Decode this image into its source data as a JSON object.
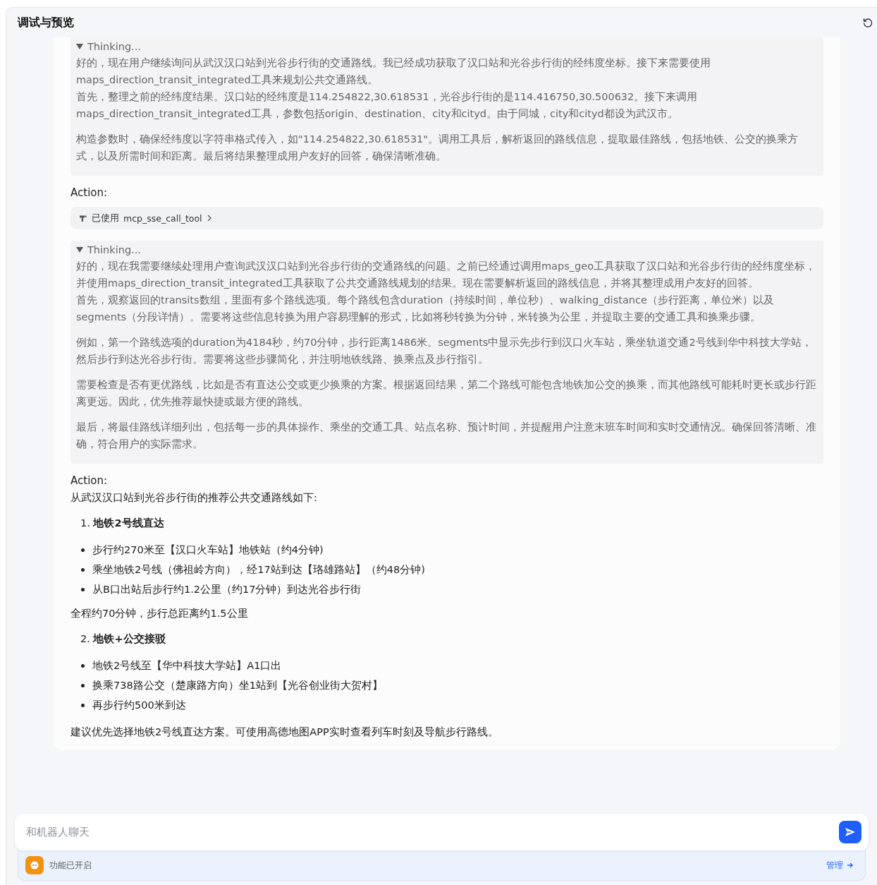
{
  "header": {
    "title": "调试与预览"
  },
  "blocks": [
    {
      "kind": "thinking",
      "title": "Thinking...",
      "expanded": true,
      "paragraphs": [
        [
          "好的，现在用户继续询问从武汉汉口站到光谷步行街的交通路线。我已经成功获取了汉口站和光谷步行街的经纬度坐标。接下来需要使用maps_direction_transit_integrated工具来规划公共交通路线。",
          "首先，整理之前的经纬度结果。汉口站的经纬度是114.254822,30.618531，光谷步行街的是114.416750,30.500632。接下来调用maps_direction_transit_integrated工具，参数包括origin、destination、city和cityd。由于同城，city和cityd都设为武汉市。"
        ],
        [
          "构造参数时，确保经纬度以字符串格式传入，如\"114.254822,30.618531\"。调用工具后，解析返回的路线信息，提取最佳路线，包括地铁、公交的换乘方式，以及所需时间和距离。最后将结果整理成用户友好的回答，确保清晰准确。"
        ]
      ]
    },
    {
      "kind": "action",
      "label": "Action:",
      "tool": {
        "prefix": "已使用",
        "name": "mcp_sse_call_tool"
      }
    },
    {
      "kind": "thinking",
      "title": "Thinking...",
      "expanded": true,
      "paragraphs": [
        [
          "好的，现在我需要继续处理用户查询武汉汉口站到光谷步行街的交通路线的问题。之前已经通过调用maps_geo工具获取了汉口站和光谷步行街的经纬度坐标，并使用maps_direction_transit_integrated工具获取了公共交通路线规划的结果。现在需要解析返回的路线信息，并将其整理成用户友好的回答。",
          "首先，观察返回的transits数组，里面有多个路线选项。每个路线包含duration（持续时间，单位秒）、walking_distance（步行距离，单位米）以及segments（分段详情）。需要将这些信息转换为用户容易理解的形式，比如将秒转换为分钟，米转换为公里，并提取主要的交通工具和换乘步骤。"
        ],
        [
          "例如，第一个路线选项的duration为4184秒，约70分钟，步行距离1486米。segments中显示先步行到汉口火车站，乘坐轨道交通2号线到华中科技大学站，然后步行到达光谷步行街。需要将这些步骤简化，并注明地铁线路、换乘点及步行指引。"
        ],
        [
          "需要检查是否有更优路线，比如是否有直达公交或更少换乘的方案。根据返回结果，第二个路线可能包含地铁加公交的换乘，而其他路线可能耗时更长或步行距离更远。因此，优先推荐最快捷或最方便的路线。"
        ],
        [
          "最后，将最佳路线详细列出，包括每一步的具体操作、乘坐的交通工具、站点名称、预计时间，并提醒用户注意末班车时间和实时交通情况。确保回答清晰、准确，符合用户的实际需求。"
        ]
      ]
    },
    {
      "kind": "answer",
      "label": "Action:",
      "intro": "从武汉汉口站到光谷步行街的推荐公共交通路线如下:",
      "sections": [
        {
          "number": "1.",
          "title": "地铁2号线直达",
          "bullets": [
            "步行约270米至【汉口火车站】地铁站（约4分钟)",
            "乘坐地铁2号线（佛祖岭方向），经17站到达【珞雄路站】（约48分钟)",
            "从B口出站后步行约1.2公里（约17分钟）到达光谷步行街"
          ],
          "note": "全程约70分钟，步行总距离约1.5公里"
        },
        {
          "number": "2.",
          "title": "地铁+公交接驳",
          "bullets": [
            "地铁2号线至【华中科技大学站】A1口出",
            "换乘738路公交（楚康路方向）坐1站到【光谷创业街大贺村】",
            "再步行约500米到达"
          ]
        }
      ],
      "conclusion": "建议优先选择地铁2号线直达方案。可使用高德地图APP实时查看列车时刻及导航步行路线。"
    }
  ],
  "composer": {
    "placeholder": "和机器人聊天"
  },
  "feature_bar": {
    "status": "功能已开启",
    "manage": "管理"
  }
}
